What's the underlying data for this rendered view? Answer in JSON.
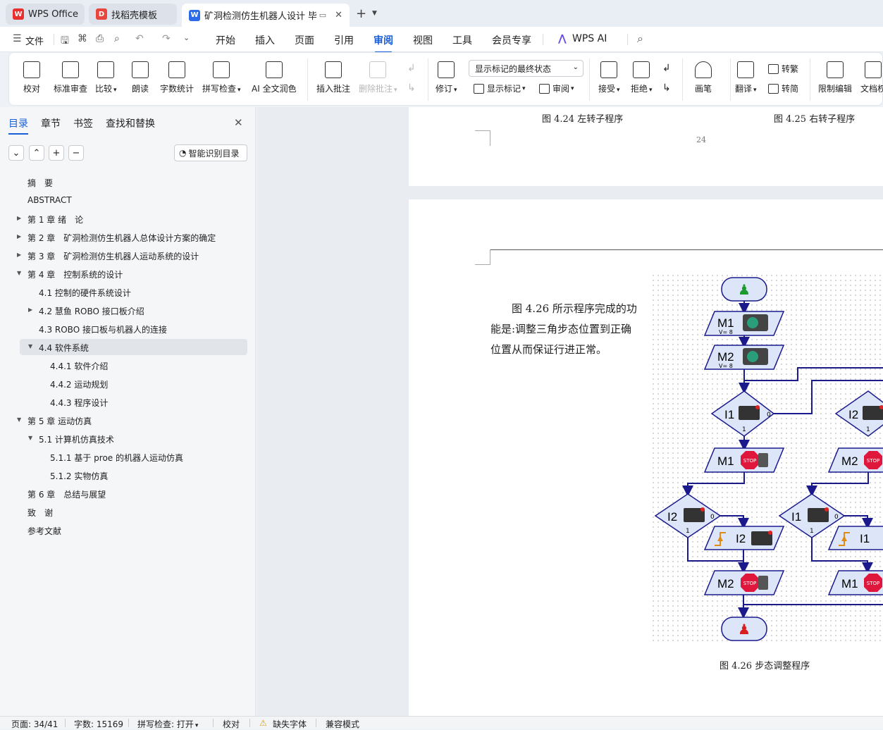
{
  "tabs": [
    {
      "label": "WPS Office",
      "icon": "wps-logo-icon"
    },
    {
      "label": "找稻壳模板",
      "icon": "docer-icon"
    },
    {
      "label": "矿洞检测仿生机器人设计 毕业",
      "icon": "word-doc-icon"
    }
  ],
  "menu": {
    "file": "文件",
    "items": [
      "开始",
      "插入",
      "页面",
      "引用",
      "审阅",
      "视图",
      "工具",
      "会员专享"
    ],
    "active": "审阅",
    "ai": "WPS AI"
  },
  "ribbon": {
    "proof": "校对",
    "std_review": "标准审查",
    "compare": "比较",
    "read": "朗读",
    "word_count": "字数统计",
    "spell": "拼写检查",
    "ai_polish": "AI 全文润色",
    "insert_comment": "插入批注",
    "delete_comment": "删除批注",
    "track": "修订",
    "markup_state": "显示标记的最终状态",
    "show_markup": "显示标记",
    "review": "审阅",
    "accept": "接受",
    "reject": "拒绝",
    "pen": "画笔",
    "translate": "翻译",
    "to_trad": "转繁",
    "to_simp": "转简",
    "restrict": "限制编辑",
    "doc_perm": "文档权"
  },
  "sidebar": {
    "tabs": [
      "目录",
      "章节",
      "书签",
      "查找和替换"
    ],
    "smart": "智能识别目录",
    "toc": [
      {
        "label": "摘　要",
        "level": 1,
        "arrow": ""
      },
      {
        "label": "ABSTRACT",
        "level": 1,
        "arrow": ""
      },
      {
        "label": "第 1 章  绪　论",
        "level": 1,
        "arrow": "right"
      },
      {
        "label": "第 2 章　矿洞检测仿生机器人总体设计方案的确定",
        "level": 1,
        "arrow": "right"
      },
      {
        "label": "第 3 章　矿洞检测仿生机器人运动系统的设计",
        "level": 1,
        "arrow": "right"
      },
      {
        "label": "第 4 章　控制系统的设计",
        "level": 1,
        "arrow": "down"
      },
      {
        "label": "4.1 控制的硬件系统设计",
        "level": 2,
        "arrow": ""
      },
      {
        "label": "4.2 慧鱼  ROBO 接口板介绍",
        "level": 2,
        "arrow": "right"
      },
      {
        "label": "4.3 ROBO 接口板与机器人的连接",
        "level": 2,
        "arrow": ""
      },
      {
        "label": "4.4 软件系统",
        "level": 2,
        "arrow": "down",
        "selected": true
      },
      {
        "label": "4.4.1 软件介绍",
        "level": 3,
        "arrow": ""
      },
      {
        "label": "4.4.2 运动规划",
        "level": 3,
        "arrow": ""
      },
      {
        "label": "4.4.3 程序设计",
        "level": 3,
        "arrow": ""
      },
      {
        "label": "第 5 章  运动仿真",
        "level": 1,
        "arrow": "down"
      },
      {
        "label": "5.1 计算机仿真技术",
        "level": 2,
        "arrow": "down"
      },
      {
        "label": "5.1.1 基于 proe 的机器人运动仿真",
        "level": 3,
        "arrow": ""
      },
      {
        "label": "5.1.2 实物仿真",
        "level": 3,
        "arrow": ""
      },
      {
        "label": "第 6 章　总结与展望",
        "level": 1,
        "arrow": ""
      },
      {
        "label": "致　谢",
        "level": 1,
        "arrow": ""
      },
      {
        "label": "参考文献",
        "level": 1,
        "arrow": ""
      }
    ]
  },
  "document": {
    "fig424": "图 4.24 左转子程序",
    "fig425": "图 4.25 右转子程序",
    "page_num": "24",
    "para_line1": "图 4.26 所示程序完成的功",
    "para_line2": "能是:调整三角步态位置到正确",
    "para_line3": "位置从而保证行进正常。",
    "caption": "图 4.26 步态调整程序"
  },
  "flowchart": {
    "m1": "M1",
    "m2": "M2",
    "i1": "I1",
    "i2": "I2",
    "speed": "V= 8",
    "zero": "0",
    "one": "1",
    "stop": "STOP"
  },
  "status": {
    "page": "页面: 34/41",
    "words": "字数: 15169",
    "spell": "拼写检查: 打开",
    "proof": "校对",
    "missing_font": "缺失字体",
    "compat": "兼容模式"
  }
}
